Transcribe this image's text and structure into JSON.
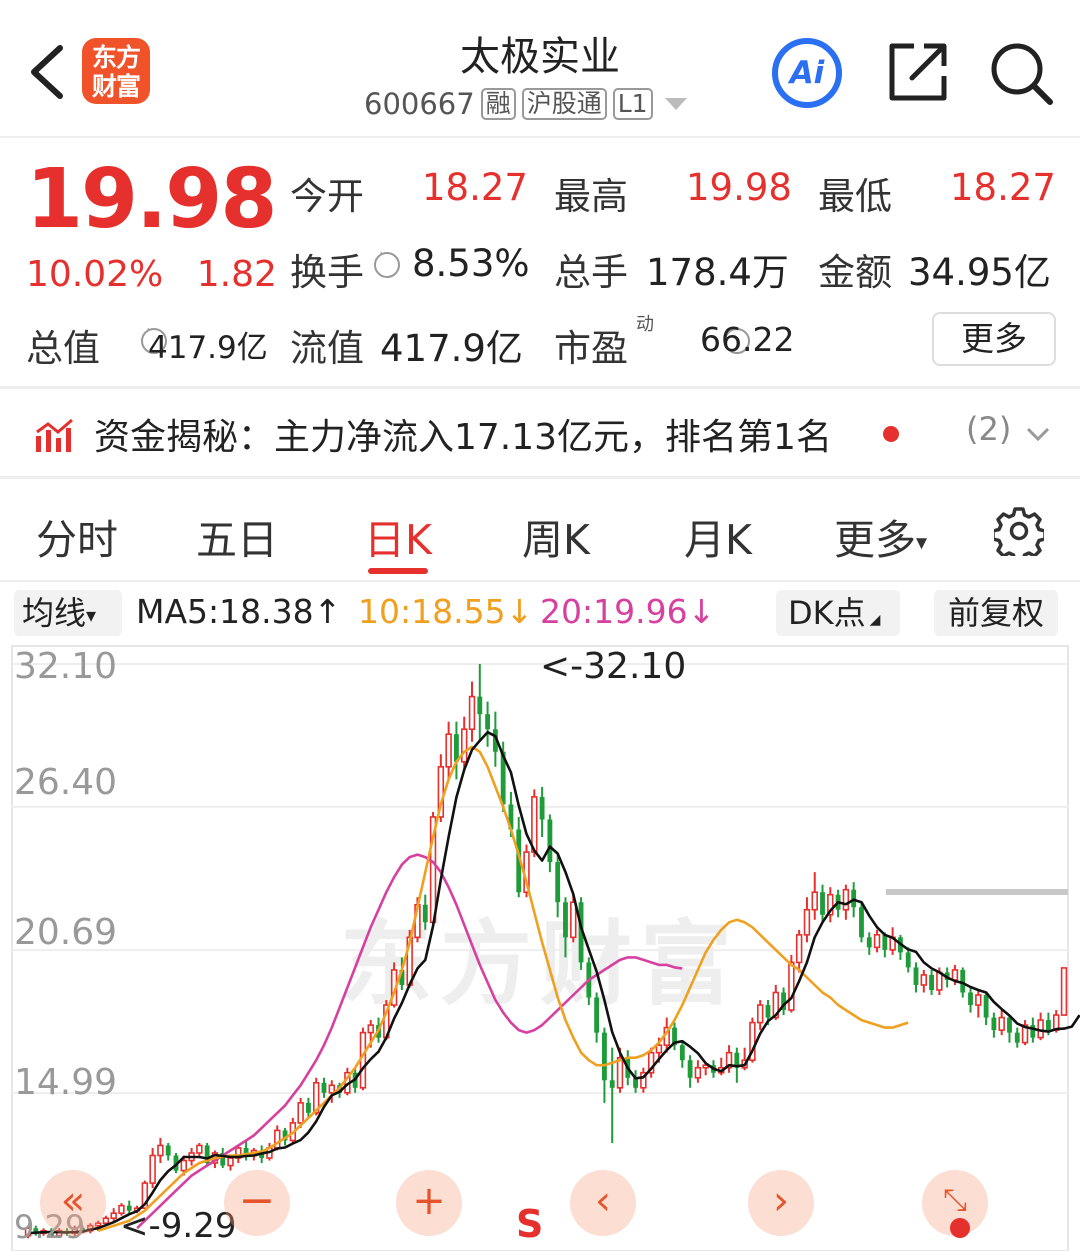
{
  "header": {
    "logo_line1": "东方",
    "logo_line2": "财富",
    "title": "太极实业",
    "code": "600667",
    "tags": [
      "融",
      "沪股通",
      "L1"
    ],
    "ai_label": "Ai"
  },
  "quote": {
    "price": "19.98",
    "change_pct": "10.02%",
    "change": "1.82",
    "stats": {
      "open_label": "今开",
      "open": "18.27",
      "high_label": "最高",
      "high": "19.98",
      "low_label": "最低",
      "low": "18.27",
      "turnover_label": "换手",
      "turnover": "8.53%",
      "volume_label": "总手",
      "volume": "178.4万",
      "amount_label": "金额",
      "amount": "34.95亿",
      "mktcap_label": "总值",
      "mktcap": "417.9亿",
      "float_label": "流值",
      "float": "417.9亿",
      "pe_label": "市盈",
      "pe_sup": "动",
      "pe": "66.22"
    },
    "more": "更多"
  },
  "fund": {
    "text": "资金揭秘：主力净流入17.13亿元，排名第1名",
    "count": "(2)"
  },
  "tabs": [
    "分时",
    "五日",
    "日K",
    "周K",
    "月K",
    "更多"
  ],
  "active_tab": 2,
  "ma_bar": {
    "dropdown": "均线",
    "ma5": "MA5:18.38",
    "ma10": "10:18.55",
    "ma20": "20:19.96",
    "dk": "DK点",
    "fq": "前复权"
  },
  "colors": {
    "up": "#e5302d",
    "down": "#1f9c3a",
    "ma5": "#111111",
    "ma10": "#f0a020",
    "ma20": "#d6409f",
    "accent": "#2b6ff2"
  },
  "chart_data": {
    "type": "candlestick",
    "y_ticks": [
      "32.10",
      "26.40",
      "20.69",
      "14.99",
      "9.29"
    ],
    "ylim": [
      9.29,
      32.1
    ],
    "max_label": "32.10",
    "min_label": "9.29",
    "watermark": "东方财富",
    "candles": [
      [
        9.3,
        9.6,
        9.2,
        9.7
      ],
      [
        9.6,
        9.4,
        9.3,
        9.7
      ],
      [
        9.4,
        9.5,
        9.3,
        9.6
      ],
      [
        9.5,
        9.3,
        9.29,
        9.6
      ],
      [
        9.3,
        9.5,
        9.3,
        9.6
      ],
      [
        9.5,
        9.4,
        9.3,
        9.6
      ],
      [
        9.4,
        9.6,
        9.3,
        9.7
      ],
      [
        9.6,
        9.5,
        9.4,
        9.7
      ],
      [
        9.5,
        9.7,
        9.4,
        9.8
      ],
      [
        9.7,
        9.8,
        9.5,
        9.9
      ],
      [
        9.8,
        10.0,
        9.7,
        10.1
      ],
      [
        10.0,
        10.2,
        9.9,
        10.4
      ],
      [
        10.2,
        10.5,
        10.1,
        10.6
      ],
      [
        10.5,
        10.3,
        10.2,
        10.7
      ],
      [
        10.3,
        10.4,
        10.2,
        10.5
      ],
      [
        10.4,
        11.4,
        10.4,
        11.5
      ],
      [
        11.4,
        12.5,
        11.2,
        12.8
      ],
      [
        12.5,
        12.9,
        12.2,
        13.2
      ],
      [
        12.9,
        12.5,
        12.3,
        13.0
      ],
      [
        12.5,
        11.9,
        11.8,
        12.6
      ],
      [
        11.9,
        12.3,
        11.7,
        12.5
      ],
      [
        12.3,
        12.6,
        12.1,
        12.8
      ],
      [
        12.6,
        12.9,
        12.4,
        13.0
      ],
      [
        12.9,
        12.2,
        12.1,
        13.0
      ],
      [
        12.2,
        12.6,
        12.0,
        12.7
      ],
      [
        12.6,
        12.1,
        12.0,
        12.8
      ],
      [
        12.1,
        12.4,
        11.9,
        12.5
      ],
      [
        12.4,
        12.8,
        12.2,
        12.9
      ],
      [
        12.8,
        12.5,
        12.3,
        13.1
      ],
      [
        12.5,
        12.7,
        12.3,
        12.8
      ],
      [
        12.7,
        12.4,
        12.2,
        12.9
      ],
      [
        12.4,
        12.8,
        12.3,
        13.0
      ],
      [
        12.8,
        13.5,
        12.7,
        13.7
      ],
      [
        13.5,
        13.1,
        12.9,
        13.6
      ],
      [
        13.1,
        13.8,
        13.0,
        14.0
      ],
      [
        13.8,
        14.6,
        13.6,
        14.8
      ],
      [
        14.6,
        14.2,
        14.0,
        14.8
      ],
      [
        14.2,
        15.4,
        14.1,
        15.6
      ],
      [
        15.4,
        15.0,
        14.8,
        15.6
      ],
      [
        15.0,
        15.3,
        14.6,
        15.5
      ],
      [
        15.3,
        15.0,
        14.8,
        15.4
      ],
      [
        15.0,
        15.8,
        14.9,
        16.0
      ],
      [
        15.8,
        15.2,
        15.0,
        16.0
      ],
      [
        15.2,
        17.4,
        15.1,
        17.6
      ],
      [
        17.4,
        17.7,
        16.8,
        17.9
      ],
      [
        17.7,
        17.2,
        17.0,
        18.0
      ],
      [
        17.2,
        18.5,
        17.1,
        18.7
      ],
      [
        18.5,
        19.9,
        18.4,
        20.2
      ],
      [
        19.9,
        19.3,
        19.1,
        20.4
      ],
      [
        19.3,
        21.2,
        19.2,
        21.5
      ],
      [
        21.2,
        22.5,
        21.0,
        22.8
      ],
      [
        22.5,
        21.8,
        21.5,
        22.9
      ],
      [
        21.8,
        26.0,
        21.7,
        26.2
      ],
      [
        26.0,
        28.0,
        25.8,
        28.5
      ],
      [
        28.0,
        29.3,
        27.5,
        29.8
      ],
      [
        29.3,
        28.2,
        27.5,
        29.8
      ],
      [
        28.2,
        29.5,
        27.8,
        30.0
      ],
      [
        29.5,
        30.8,
        29.0,
        31.4
      ],
      [
        30.8,
        30.1,
        29.0,
        32.1
      ],
      [
        30.1,
        29.5,
        28.8,
        30.6
      ],
      [
        29.5,
        28.6,
        28.0,
        30.2
      ],
      [
        28.6,
        26.5,
        26.2,
        29.0
      ],
      [
        26.5,
        25.5,
        25.2,
        27.0
      ],
      [
        25.5,
        23.0,
        22.8,
        26.0
      ],
      [
        23.0,
        24.6,
        22.8,
        24.9
      ],
      [
        24.6,
        26.8,
        24.4,
        27.1
      ],
      [
        26.8,
        25.9,
        25.2,
        27.2
      ],
      [
        25.9,
        24.2,
        23.8,
        26.1
      ],
      [
        24.2,
        22.6,
        22.0,
        24.5
      ],
      [
        22.6,
        21.2,
        20.4,
        22.8
      ],
      [
        21.2,
        22.6,
        21.0,
        22.9
      ],
      [
        22.6,
        20.2,
        19.9,
        22.8
      ],
      [
        20.2,
        18.8,
        18.5,
        20.4
      ],
      [
        18.8,
        17.4,
        17.0,
        19.0
      ],
      [
        17.4,
        15.5,
        14.6,
        17.6
      ],
      [
        15.5,
        15.2,
        13.0,
        16.8
      ],
      [
        15.2,
        16.4,
        15.0,
        16.8
      ],
      [
        16.4,
        15.6,
        15.3,
        16.7
      ],
      [
        15.6,
        15.2,
        15.0,
        15.9
      ],
      [
        15.2,
        15.8,
        15.0,
        16.0
      ],
      [
        15.8,
        16.6,
        15.6,
        16.8
      ],
      [
        16.6,
        16.9,
        16.2,
        17.2
      ],
      [
        16.9,
        17.6,
        16.6,
        18.0
      ],
      [
        17.6,
        16.9,
        16.7,
        17.8
      ],
      [
        16.9,
        16.3,
        16.0,
        17.1
      ],
      [
        16.3,
        15.6,
        15.2,
        16.5
      ],
      [
        15.6,
        16.0,
        15.4,
        16.3
      ],
      [
        16.0,
        16.1,
        15.7,
        16.2
      ],
      [
        16.1,
        15.8,
        15.6,
        16.3
      ],
      [
        15.8,
        16.0,
        15.7,
        16.4
      ],
      [
        16.0,
        16.6,
        15.8,
        16.9
      ],
      [
        16.6,
        16.0,
        15.4,
        16.8
      ],
      [
        16.0,
        16.3,
        15.9,
        16.8
      ],
      [
        16.3,
        17.8,
        16.2,
        18.0
      ],
      [
        17.8,
        18.5,
        17.5,
        18.7
      ],
      [
        18.5,
        18.0,
        17.7,
        18.7
      ],
      [
        18.0,
        19.0,
        17.9,
        19.3
      ],
      [
        19.0,
        18.3,
        18.1,
        19.2
      ],
      [
        18.3,
        20.2,
        18.2,
        20.5
      ],
      [
        20.2,
        21.3,
        19.8,
        21.5
      ],
      [
        21.3,
        22.3,
        21.0,
        22.8
      ],
      [
        22.3,
        23.0,
        21.9,
        23.8
      ],
      [
        23.0,
        22.1,
        21.8,
        23.3
      ],
      [
        22.1,
        22.9,
        21.8,
        23.2
      ],
      [
        22.9,
        22.3,
        22.0,
        23.1
      ],
      [
        22.3,
        23.1,
        21.9,
        23.3
      ],
      [
        23.1,
        22.4,
        22.0,
        23.4
      ],
      [
        22.4,
        21.2,
        21.0,
        22.6
      ],
      [
        21.2,
        20.8,
        20.5,
        21.4
      ],
      [
        20.8,
        21.3,
        20.6,
        21.5
      ],
      [
        21.3,
        20.7,
        20.4,
        21.4
      ],
      [
        20.7,
        21.2,
        20.5,
        21.6
      ],
      [
        21.2,
        20.6,
        20.3,
        21.3
      ],
      [
        20.6,
        20.0,
        19.8,
        20.8
      ],
      [
        20.0,
        19.3,
        19.0,
        20.2
      ],
      [
        19.3,
        19.7,
        19.0,
        19.9
      ],
      [
        19.7,
        19.1,
        18.9,
        19.9
      ],
      [
        19.1,
        19.8,
        18.9,
        20.0
      ],
      [
        19.8,
        19.5,
        19.2,
        20.0
      ],
      [
        19.5,
        19.9,
        19.3,
        20.1
      ],
      [
        19.9,
        19.0,
        18.8,
        20.0
      ],
      [
        19.0,
        18.5,
        18.2,
        19.2
      ],
      [
        18.5,
        18.9,
        18.0,
        19.1
      ],
      [
        18.9,
        18.0,
        17.7,
        19.0
      ],
      [
        18.0,
        17.5,
        17.2,
        18.2
      ],
      [
        17.5,
        18.0,
        17.3,
        18.3
      ],
      [
        18.0,
        17.4,
        17.0,
        18.1
      ],
      [
        17.4,
        17.0,
        16.8,
        17.6
      ],
      [
        17.0,
        17.7,
        16.9,
        17.9
      ],
      [
        17.7,
        17.2,
        17.0,
        18.0
      ],
      [
        17.2,
        17.9,
        17.1,
        18.2
      ],
      [
        17.9,
        17.5,
        17.3,
        18.2
      ],
      [
        17.5,
        18.1,
        17.4,
        18.3
      ],
      [
        18.1,
        19.98,
        18.27,
        19.98
      ]
    ],
    "ma5": [
      9.4,
      9.42,
      9.44,
      9.45,
      9.44,
      9.43,
      9.45,
      9.46,
      9.55,
      9.6,
      9.72,
      9.84,
      10.0,
      10.16,
      10.28,
      10.56,
      11.02,
      11.52,
      11.88,
      12.12,
      12.44,
      12.44,
      12.44,
      12.38,
      12.52,
      12.48,
      12.44,
      12.44,
      12.48,
      12.5,
      12.58,
      12.64,
      12.78,
      12.82,
      12.98,
      13.12,
      13.42,
      13.86,
      14.44,
      14.9,
      15.04,
      15.34,
      15.54,
      15.98,
      16.34,
      16.64,
      17.2,
      17.96,
      18.58,
      19.32,
      19.96,
      20.3,
      21.66,
      23.5,
      25.2,
      26.78,
      27.88,
      28.68,
      29.04,
      29.38,
      29.22,
      28.44,
      27.78,
      26.46,
      25.32,
      24.66,
      24.26,
      24.82,
      24.54,
      23.8,
      22.92,
      21.6,
      20.72,
      19.84,
      18.7,
      17.42,
      16.6,
      15.98,
      15.58,
      15.62,
      15.96,
      16.34,
      16.7,
      17.0,
      17.06,
      16.84,
      16.58,
      16.18,
      15.96,
      15.86,
      16.1,
      16.06,
      16.1,
      16.68,
      17.36,
      17.86,
      18.1,
      18.5,
      18.78,
      19.46,
      20.2,
      21.2,
      21.8,
      22.26,
      22.6,
      22.52,
      22.7,
      22.6,
      22.06,
      21.6,
      21.3,
      21.18,
      20.94,
      20.72,
      20.62,
      20.2,
      19.96,
      19.8,
      19.6,
      19.46,
      19.38,
      19.22,
      19.1,
      19.0,
      18.62,
      18.34,
      18.08,
      17.76,
      17.62,
      17.56,
      17.48,
      17.44,
      17.54,
      17.56,
      17.64,
      18.1
    ],
    "ma10_from": 9,
    "ma10": [
      9.5,
      9.6,
      9.7,
      9.8,
      9.9,
      10.1,
      10.3,
      10.6,
      10.9,
      11.2,
      11.5,
      11.8,
      12.0,
      12.2,
      12.3,
      12.4,
      12.45,
      12.5,
      12.5,
      12.55,
      12.6,
      12.65,
      12.8,
      13.0,
      13.2,
      13.4,
      13.7,
      14.0,
      14.3,
      14.6,
      14.9,
      15.2,
      15.6,
      16.0,
      16.5,
      17.0,
      17.5,
      18.2,
      19.0,
      19.9,
      21.0,
      22.4,
      23.8,
      25.2,
      26.5,
      27.5,
      28.2,
      28.6,
      28.8,
      28.6,
      28.0,
      27.2,
      26.4,
      25.5,
      24.5,
      23.4,
      22.2,
      21.0,
      19.9,
      18.8,
      17.9,
      17.2,
      16.6,
      16.3,
      16.1,
      16.1,
      16.2,
      16.3,
      16.4,
      16.4,
      16.5,
      16.7,
      17.0,
      17.4,
      17.9,
      18.5,
      19.2,
      19.9,
      20.6,
      21.1,
      21.5,
      21.8,
      21.9,
      21.8,
      21.6,
      21.3,
      21.0,
      20.7,
      20.4,
      20.1,
      19.9,
      19.6,
      19.3,
      19.0,
      18.8,
      18.5,
      18.3,
      18.1,
      17.9,
      17.8,
      17.7,
      17.6,
      17.6,
      17.7,
      17.8
    ],
    "ma20_from": 14,
    "ma20": [
      9.6,
      9.9,
      10.2,
      10.5,
      10.8,
      11.1,
      11.4,
      11.7,
      11.9,
      12.1,
      12.3,
      12.5,
      12.7,
      12.9,
      13.1,
      13.3,
      13.6,
      13.9,
      14.2,
      14.5,
      14.9,
      15.3,
      15.8,
      16.3,
      16.9,
      17.6,
      18.4,
      19.2,
      20.0,
      20.8,
      21.6,
      22.3,
      23.0,
      23.6,
      24.1,
      24.4,
      24.5,
      24.4,
      24.2,
      23.8,
      23.2,
      22.5,
      21.7,
      20.9,
      20.1,
      19.4,
      18.7,
      18.2,
      17.8,
      17.5,
      17.4,
      17.5,
      17.7,
      18.0,
      18.3,
      18.6,
      18.9,
      19.2,
      19.5,
      19.7,
      19.9,
      20.1,
      20.3,
      20.4,
      20.4,
      20.3,
      20.2,
      20.1,
      20.1,
      20.0,
      19.96
    ]
  }
}
